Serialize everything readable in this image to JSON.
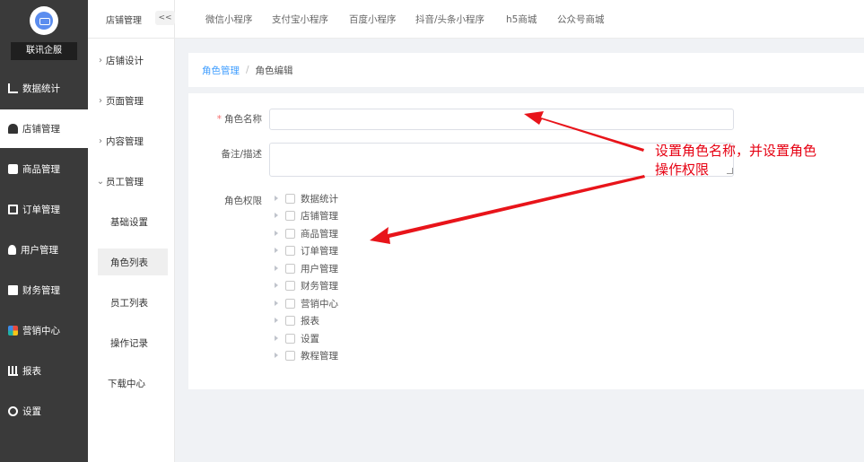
{
  "brand": {
    "name": "联讯企服"
  },
  "sidebar": {
    "items": [
      {
        "label": "数据统计",
        "icon": "chart-icon"
      },
      {
        "label": "店铺管理",
        "icon": "store-icon",
        "active": true
      },
      {
        "label": "商品管理",
        "icon": "goods-icon"
      },
      {
        "label": "订单管理",
        "icon": "order-icon"
      },
      {
        "label": "用户管理",
        "icon": "user-icon"
      },
      {
        "label": "财务管理",
        "icon": "finance-icon"
      },
      {
        "label": "营销中心",
        "icon": "marketing-icon"
      },
      {
        "label": "报表",
        "icon": "report-icon"
      },
      {
        "label": "设置",
        "icon": "settings-icon"
      }
    ]
  },
  "submenu": {
    "title": "店铺管理",
    "collapse_label": "<<",
    "groups": [
      {
        "label": "店铺设计"
      },
      {
        "label": "页面管理"
      },
      {
        "label": "内容管理"
      },
      {
        "label": "员工管理"
      }
    ],
    "children": [
      {
        "label": "基础设置"
      },
      {
        "label": "角色列表",
        "active": true
      },
      {
        "label": "员工列表"
      },
      {
        "label": "操作记录"
      }
    ],
    "download": "下载中心"
  },
  "toptabs": [
    "微信小程序",
    "支付宝小程序",
    "百度小程序",
    "抖音/头条小程序",
    "h5商城",
    "公众号商城"
  ],
  "breadcrumb": {
    "parent": "角色管理",
    "separator": "/",
    "current": "角色编辑"
  },
  "form": {
    "required_mark": "*",
    "name_label": "角色名称",
    "name_value": "",
    "desc_label": "备注/描述",
    "desc_value": "",
    "perm_label": "角色权限",
    "permissions": [
      "数据统计",
      "店铺管理",
      "商品管理",
      "订单管理",
      "用户管理",
      "财务管理",
      "营销中心",
      "报表",
      "设置",
      "教程管理"
    ]
  },
  "annotation": {
    "text": "设置角色名称，并设置角色操作权限",
    "color": "#e60012"
  },
  "colors": {
    "sidebar_bg": "#3a3a3a",
    "accent": "#409eff",
    "required": "#f56c6c"
  }
}
